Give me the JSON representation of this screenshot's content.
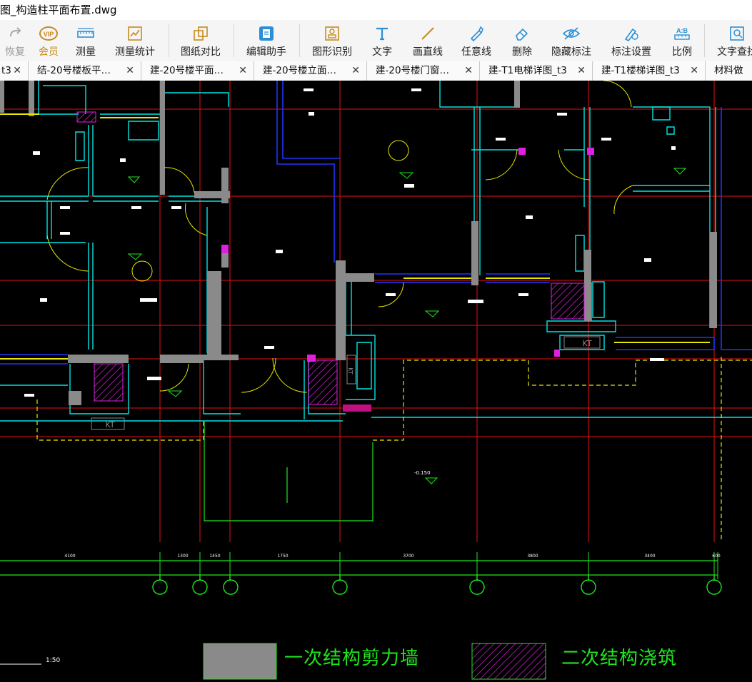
{
  "window": {
    "title": "图_构造柱平面布置.dwg"
  },
  "toolbar": {
    "items": [
      {
        "label": "恢复",
        "icon": "redo-icon"
      },
      {
        "label": "会员",
        "icon": "vip-icon"
      },
      {
        "label": "测量",
        "icon": "ruler-icon"
      },
      {
        "label": "测量统计",
        "icon": "measure-stats-icon"
      },
      {
        "label": "图纸对比",
        "icon": "compare-icon"
      },
      {
        "label": "编辑助手",
        "icon": "edit-assistant-icon"
      },
      {
        "label": "图形识别",
        "icon": "shape-recognition-icon"
      },
      {
        "label": "文字",
        "icon": "text-icon"
      },
      {
        "label": "画直线",
        "icon": "line-icon"
      },
      {
        "label": "任意线",
        "icon": "freehand-icon"
      },
      {
        "label": "删除",
        "icon": "eraser-icon"
      },
      {
        "label": "隐藏标注",
        "icon": "eye-hide-icon"
      },
      {
        "label": "标注设置",
        "icon": "annotation-settings-icon"
      },
      {
        "label": "比例",
        "icon": "scale-icon"
      },
      {
        "label": "文字查找",
        "icon": "text-search-icon"
      }
    ],
    "vip_badge": "VIP",
    "scale_badge": "A:B"
  },
  "tabs": [
    {
      "label": "t3",
      "close": "✕"
    },
    {
      "label": "结-20号楼板平…",
      "close": "✕"
    },
    {
      "label": "建-20号楼平面…",
      "close": "✕"
    },
    {
      "label": "建-20号楼立面…",
      "close": "✕"
    },
    {
      "label": "建-20号楼门窗…",
      "close": "✕"
    },
    {
      "label": "建-T1电梯详图_t3",
      "close": "✕"
    },
    {
      "label": "建-T1楼梯详图_t3",
      "close": "✕"
    },
    {
      "label": "材料做",
      "close": ""
    }
  ],
  "drawing": {
    "kt_labels": [
      "KT",
      "KT",
      "KT"
    ],
    "dimensions": [
      "4100",
      "1300",
      "1450",
      "1750",
      "3700",
      "3800",
      "3400",
      "600"
    ],
    "elevation_mark": "-0.150",
    "scale_text": "1:50",
    "colors": {
      "axis_red": "#e81010",
      "wall_cyan": "#00e5e5",
      "wall_blue": "#2233ff",
      "magenta": "#e020e0",
      "yellow": "#e6e600",
      "green": "#1ee61e",
      "gray": "#8a8a8a",
      "white": "#ffffff"
    }
  },
  "legend": {
    "shear_wall_label": "一次结构剪力墙",
    "secondary_pour_label": "二次结构浇筑"
  }
}
